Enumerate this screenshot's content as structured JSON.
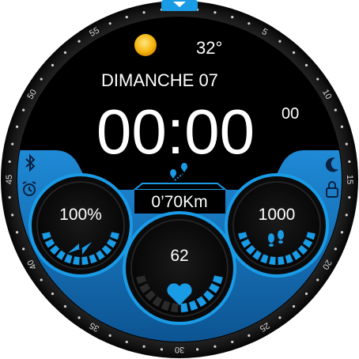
{
  "weather": {
    "icon": "sun-icon",
    "temperature": "32°"
  },
  "date": {
    "label": "DIMANCHE 07"
  },
  "time": {
    "main": "00:00",
    "seconds": "00"
  },
  "bezel": {
    "labels": [
      "55",
      "5",
      "10",
      "15",
      "20",
      "25",
      "30",
      "35",
      "40",
      "45",
      "50"
    ]
  },
  "left_status": {
    "icons": [
      "bluetooth-icon",
      "alarm-icon"
    ]
  },
  "right_status": {
    "icons": [
      "moon-icon",
      "lock-icon"
    ]
  },
  "distance": {
    "icon": "route-icon",
    "value": "0’70Km"
  },
  "battery": {
    "value": "100%",
    "icon": "lightning-icon",
    "level": 1.0
  },
  "heart_rate": {
    "value": "62",
    "icon": "heart-icon"
  },
  "steps": {
    "value": "1000",
    "icon": "footprints-icon"
  },
  "colors": {
    "accent": "#1a9be6",
    "accent_dark": "#0a5f9e",
    "background": "#000000",
    "bezel": "#1c1c1c"
  }
}
